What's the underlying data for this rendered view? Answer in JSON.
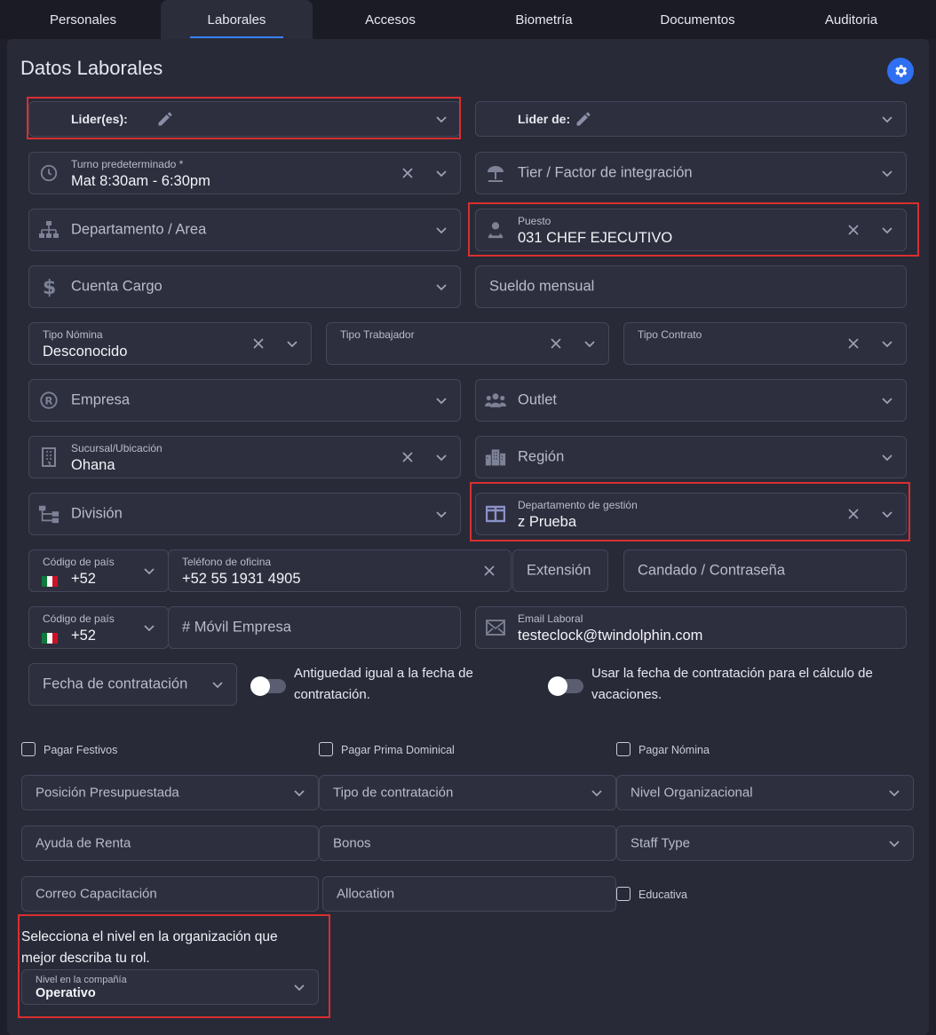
{
  "tabs": [
    "Personales",
    "Laborales",
    "Accesos",
    "Biometría",
    "Documentos",
    "Auditoria"
  ],
  "title": "Datos Laborales",
  "fields": {
    "lideres": "Lider(es):",
    "lider_de": "Lider de:",
    "turno_label": "Turno predeterminado *",
    "turno_value": "Mat 8:30am - 6:30pm",
    "tier": "Tier / Factor de integración",
    "departamento": "Departamento / Area",
    "puesto_label": "Puesto",
    "puesto_value": "031 CHEF EJECUTIVO",
    "cuenta_cargo": "Cuenta Cargo",
    "sueldo": "Sueldo mensual",
    "tipo_nomina_label": "Tipo Nómina",
    "tipo_nomina_value": "Desconocido",
    "tipo_trabajador_label": "Tipo Trabajador",
    "tipo_contrato_label": "Tipo Contrato",
    "empresa": "Empresa",
    "outlet": "Outlet",
    "sucursal_label": "Sucursal/Ubicación",
    "sucursal_value": "Ohana",
    "region": "Región",
    "division": "División",
    "depto_gestion_label": "Departamento de gestión",
    "depto_gestion_value": "z Prueba",
    "codigo_pais_label": "Código de país",
    "codigo_pais_value": "+52",
    "telefono_oficina_label": "Teléfono de oficina",
    "telefono_oficina_value": "+52 55 1931 4905",
    "extension": "Extensión",
    "candado": "Candado / Contraseña",
    "movil_empresa": "# Móvil Empresa",
    "email_label": "Email Laboral",
    "email_value": "testeclock@twindolphin.com",
    "fecha_contratacion": "Fecha de contratación"
  },
  "toggles": {
    "antiguedad": "Antiguedad igual a la fecha de contratación.",
    "vacaciones": "Usar la fecha de contratación para el cálculo de vacaciones."
  },
  "checkboxes": {
    "pagar_festivos": "Pagar Festivos",
    "pagar_prima": "Pagar Prima Dominical",
    "pagar_nomina": "Pagar Nómina",
    "educativa": "Educativa"
  },
  "extra": {
    "posicion": "Posición Presupuestada",
    "tipo_contratacion": "Tipo de contratación",
    "nivel_org": "Nivel Organizacional",
    "ayuda_renta": "Ayuda de Renta",
    "bonos": "Bonos",
    "staff_type": "Staff Type",
    "correo_cap": "Correo Capacitación",
    "allocation": "Allocation"
  },
  "nivel": {
    "prompt": "Selecciona el nivel en la organización que mejor describa tu rol.",
    "label": "Nivel en la compañía",
    "value": "Operativo"
  },
  "colors": {
    "accent": "#3b82f6",
    "highlight": "#d92f2f",
    "gear": "#2f6ff2"
  }
}
